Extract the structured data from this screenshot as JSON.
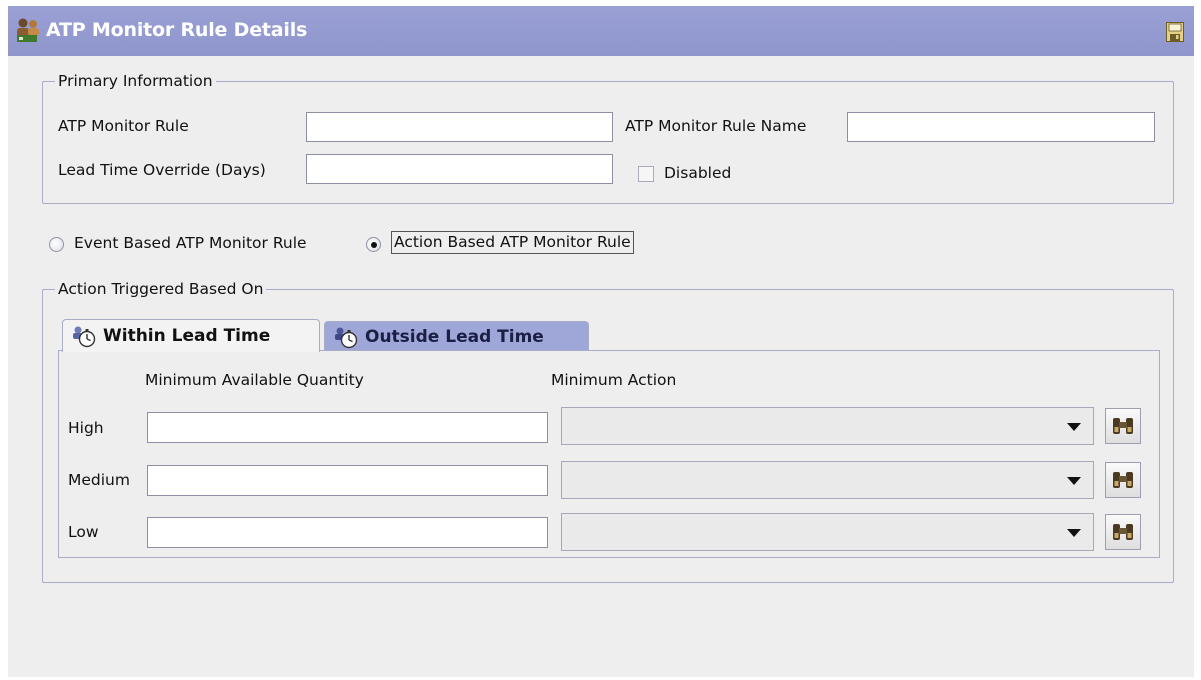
{
  "header": {
    "title": "ATP Monitor Rule Details",
    "title_icon": "rule-users-icon",
    "action_icon": "save-icon"
  },
  "primary_information": {
    "legend": "Primary Information",
    "atp_monitor_rule": {
      "label": "ATP Monitor Rule",
      "value": ""
    },
    "atp_monitor_rule_name": {
      "label": "ATP Monitor Rule Name",
      "value": ""
    },
    "lead_time_override": {
      "label": "Lead Time Override (Days)",
      "value": ""
    },
    "disabled": {
      "label": "Disabled",
      "checked": false
    }
  },
  "rule_type": {
    "options": [
      {
        "label": "Event Based ATP Monitor Rule",
        "selected": false
      },
      {
        "label": "Action Based ATP Monitor Rule",
        "selected": true
      }
    ]
  },
  "action_triggered": {
    "legend": "Action Triggered Based On",
    "tabs": [
      {
        "label": "Within Lead Time",
        "icon": "stopwatch-icon",
        "active": true
      },
      {
        "label": "Outside Lead Time",
        "icon": "stopwatch-icon",
        "active": false
      }
    ],
    "columns": {
      "quantity": "Minimum Available Quantity",
      "action": "Minimum Action"
    },
    "rows": [
      {
        "label": "High",
        "quantity": "",
        "action": ""
      },
      {
        "label": "Medium",
        "quantity": "",
        "action": ""
      },
      {
        "label": "Low",
        "quantity": "",
        "action": ""
      }
    ]
  },
  "colors": {
    "titlebar": "#9aa0d4",
    "panel_background": "#eeeeee",
    "active_tab": "#f3f3f3",
    "inactive_tab": "#9fa6d8",
    "group_border": "#a8acc4"
  }
}
